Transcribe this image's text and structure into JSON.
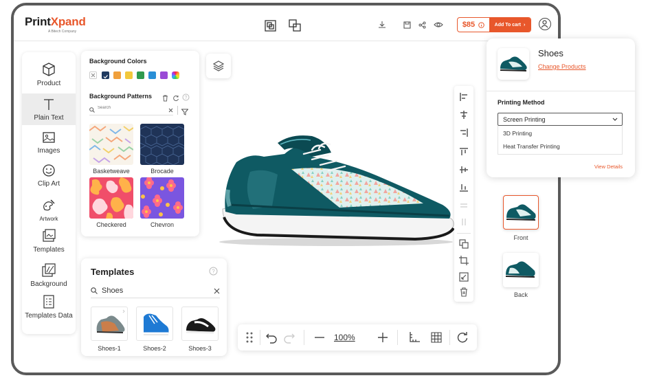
{
  "brand": {
    "name_part1": "Print",
    "name_part2": "Xpand",
    "tagline": "A Bitech Company"
  },
  "header": {
    "price": "$85",
    "cart_label": "Add To cart"
  },
  "sidebar": {
    "items": [
      {
        "label": "Product"
      },
      {
        "label": "Plain Text"
      },
      {
        "label": "Images"
      },
      {
        "label": "Clip Art"
      },
      {
        "label": "Artwork"
      },
      {
        "label": "Templates"
      },
      {
        "label": "Background"
      },
      {
        "label": "Templates Data"
      }
    ]
  },
  "background_panel": {
    "colors_title": "Background Colors",
    "colors": [
      "#1f3a5f",
      "#f0a03c",
      "#f2c83c",
      "#2f9a4e",
      "#2a8fd6",
      "#9a4ad6"
    ],
    "patterns_title": "Background Patterns",
    "search_placeholder": "Search",
    "patterns": [
      {
        "label": "Basketweave"
      },
      {
        "label": "Brocade"
      },
      {
        "label": "Checkered"
      },
      {
        "label": "Chevron"
      }
    ]
  },
  "templates_panel": {
    "title": "Templates",
    "search_value": "Shoes",
    "items": [
      {
        "label": "Shoes-1"
      },
      {
        "label": "Shoes-2"
      },
      {
        "label": "Shoes-3"
      }
    ]
  },
  "toolbar": {
    "zoom": "100%"
  },
  "views": [
    {
      "label": "Front"
    },
    {
      "label": "Back"
    }
  ],
  "product_info": {
    "name": "Shoes",
    "change_link": "Change Products",
    "printing_method_label": "Printing Method",
    "selected_method": "Screen Printing",
    "options": [
      "3D Printing",
      "Heat Transfer Printing"
    ],
    "view_details": "View Details"
  },
  "colors": {
    "accent": "#e8572b",
    "shoe": "#0f5a63"
  }
}
